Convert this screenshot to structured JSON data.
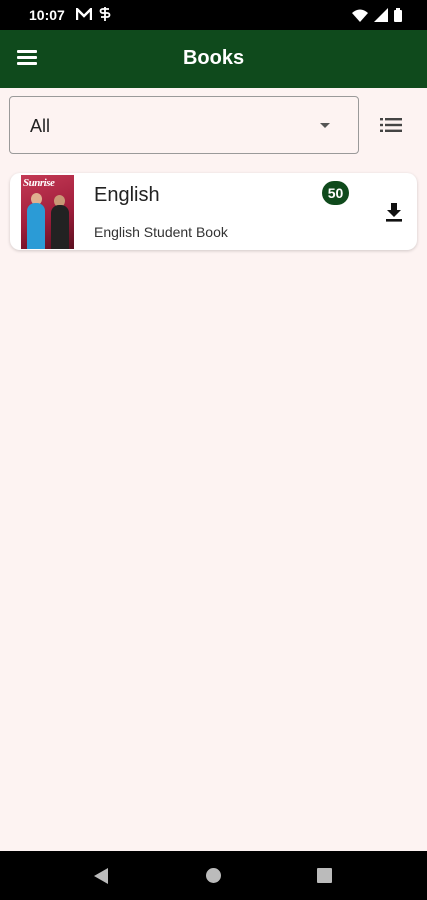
{
  "status_bar": {
    "time": "10:07",
    "icons": [
      "m-icon",
      "s-icon",
      "wifi-icon",
      "signal-icon",
      "battery-icon"
    ]
  },
  "app_bar": {
    "title": "Books",
    "menu_icon": "hamburger-menu-icon",
    "color": "#0f4a1c"
  },
  "filter": {
    "selected": "All",
    "view_toggle_icon": "list-view-icon"
  },
  "books": [
    {
      "title": "English",
      "subtitle": "English Student Book",
      "badge": "50",
      "cover_text": "Sunrise",
      "action_icon": "download-icon"
    }
  ],
  "nav_bar": {
    "icons": [
      "back-icon",
      "home-icon",
      "recents-icon"
    ]
  },
  "colors": {
    "background": "#fdf3f2",
    "accent": "#0f4a1c"
  }
}
